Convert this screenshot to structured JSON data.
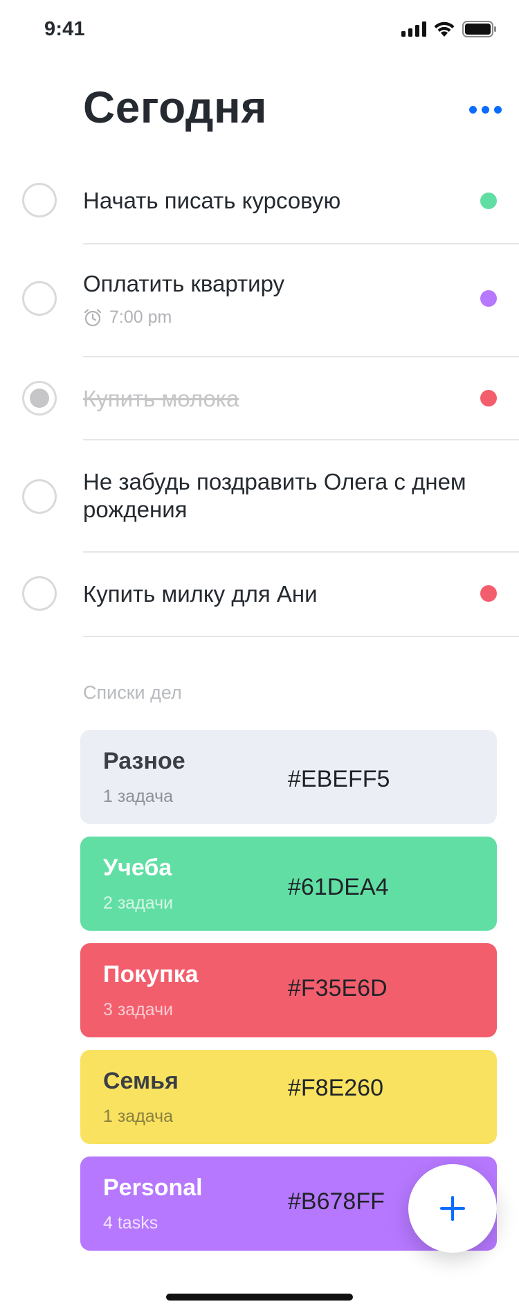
{
  "status_bar": {
    "time": "9:41"
  },
  "header": {
    "title": "Сегодня"
  },
  "tasks": [
    {
      "text": "Начать писать курсовую",
      "done": false,
      "dot_color": "#61DEA4"
    },
    {
      "text": "Оплатить квартиру",
      "time": "7:00 pm",
      "done": false,
      "dot_color": "#B678FF"
    },
    {
      "text": "Купить молока",
      "done": true,
      "dot_color": "#F35E6D"
    },
    {
      "text": "Не забудь поздравить Олега с днем рождения",
      "done": false
    },
    {
      "text": "Купить милку для Ани",
      "done": false,
      "dot_color": "#F35E6D"
    }
  ],
  "lists_section": {
    "label": "Списки дел"
  },
  "lists": [
    {
      "name": "Разное",
      "count": "1 задача",
      "hex": "#EBEFF5",
      "color": "#EBEFF5",
      "name_color": "#3B3F45",
      "count_color": "#8D9197"
    },
    {
      "name": "Учеба",
      "count": "2 задачи",
      "hex": "#61DEA4",
      "color": "#61DEA4",
      "name_color": "#FFFFFF",
      "count_color": "#D7F6E6"
    },
    {
      "name": "Покупка",
      "count": "3 задачи",
      "hex": "#F35E6D",
      "color": "#F35E6D",
      "name_color": "#FFFFFF",
      "count_color": "#FBCCD1"
    },
    {
      "name": "Семья",
      "count": "1 задача",
      "hex": "#F8E260",
      "color": "#F8E260",
      "name_color": "#3B3F45",
      "count_color": "#8A7F3E"
    },
    {
      "name": "Personal",
      "count": "4 tasks",
      "hex": "#B678FF",
      "color": "#B678FF",
      "name_color": "#FFFFFF",
      "count_color": "#F0E3FF"
    }
  ],
  "colors": {
    "accent": "#0A6CFF"
  },
  "icons": {
    "more": "more-dots-icon",
    "alarm": "alarm-clock-icon",
    "add": "plus-icon"
  }
}
